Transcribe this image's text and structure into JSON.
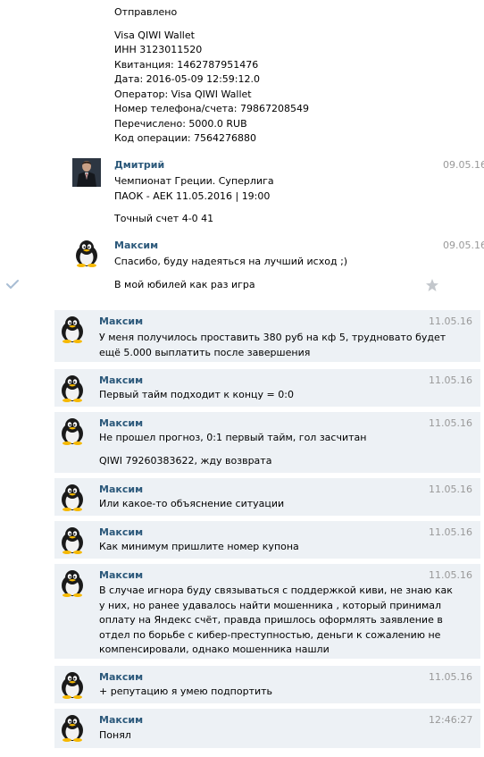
{
  "top_message": {
    "lines": [
      "Отправлено",
      "",
      "Visa QIWI Wallet",
      "ИНН 3123011520",
      "Квитанция: 1462787951476",
      "Дата: 2016-05-09 12:59:12.0",
      "Оператор: Visa QIWI Wallet",
      "Номер телефона/счета: 79867208549",
      "Перечислено: 5000.0 RUB",
      "Код операции: 7564276880"
    ]
  },
  "messages": [
    {
      "author": "Дмитрий",
      "time": "09.05.16",
      "avatar": "man-in-suit-avatar",
      "lines": [
        "Чемпионат Греции. Суперлига",
        "ПАОК - АЕК 11.05.2016 | 19:00",
        "",
        "Точный счет 4-0 41"
      ]
    },
    {
      "author": "Максим",
      "time": "09.05.16",
      "avatar": "penguin-avatar",
      "lines": [
        "Спасибо, буду надеяться на лучший исход ;)",
        "",
        "В мой юбилей как раз игра"
      ]
    },
    {
      "author": "Максим",
      "time": "11.05.16",
      "avatar": "penguin-avatar",
      "lines": [
        "У меня получилось проставить 380 руб на кф 5, трудновато будет",
        "ещё 5.000 выплатить после завершения"
      ]
    },
    {
      "author": "Максим",
      "time": "11.05.16",
      "avatar": "penguin-avatar",
      "lines": [
        "Первый тайм подходит к концу = 0:0"
      ]
    },
    {
      "author": "Максим",
      "time": "11.05.16",
      "avatar": "penguin-avatar",
      "lines": [
        "Не прошел прогноз, 0:1 первый тайм, гол засчитан",
        "",
        "QIWI 79260383622, жду возврата"
      ]
    },
    {
      "author": "Максим",
      "time": "11.05.16",
      "avatar": "penguin-avatar",
      "lines": [
        "Или какое-то объяснение ситуации"
      ]
    },
    {
      "author": "Максим",
      "time": "11.05.16",
      "avatar": "penguin-avatar",
      "lines": [
        "Как минимум пришлите номер купона"
      ]
    },
    {
      "author": "Максим",
      "time": "11.05.16",
      "avatar": "penguin-avatar",
      "lines": [
        "В случае игнора буду связываться с поддержкой киви, не знаю как",
        "у них, но ранее удавалось найти мошенника , который принимал",
        "оплату на Яндекс счёт, правда пришлось оформлять заявление в",
        "отдел по борьбе с кибер-преступностью, деньги к сожалению не",
        "компенсировали, однако мошенника нашли"
      ]
    },
    {
      "author": "Максим",
      "time": "11.05.16",
      "avatar": "penguin-avatar",
      "lines": [
        "+ репутацию я умею подпортить"
      ]
    },
    {
      "author": "Максим",
      "time": "12:46:27",
      "avatar": "penguin-avatar",
      "lines": [
        "Понял"
      ]
    }
  ],
  "icons": {
    "read_check": "check-icon",
    "favorite": "star-icon"
  },
  "colors": {
    "author": "#2b587a",
    "time": "#999999",
    "unread_bg": "#edf1f5"
  }
}
